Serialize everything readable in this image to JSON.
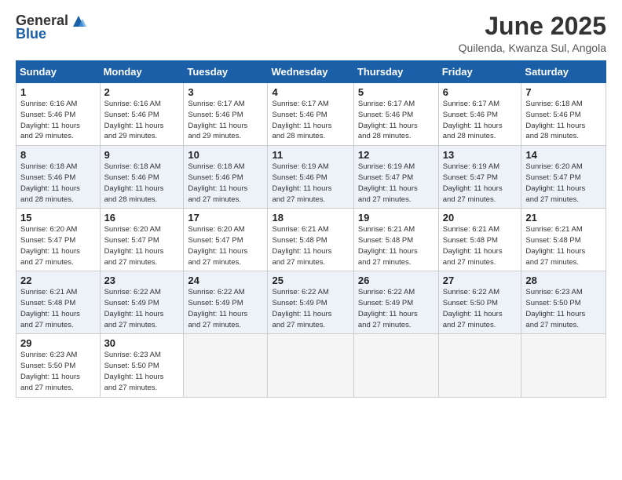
{
  "header": {
    "logo_general": "General",
    "logo_blue": "Blue",
    "month_title": "June 2025",
    "location": "Quilenda, Kwanza Sul, Angola"
  },
  "calendar": {
    "days_of_week": [
      "Sunday",
      "Monday",
      "Tuesday",
      "Wednesday",
      "Thursday",
      "Friday",
      "Saturday"
    ],
    "weeks": [
      [
        {
          "day": "",
          "info": ""
        },
        {
          "day": "2",
          "info": "Sunrise: 6:16 AM\nSunset: 5:46 PM\nDaylight: 11 hours\nand 29 minutes."
        },
        {
          "day": "3",
          "info": "Sunrise: 6:17 AM\nSunset: 5:46 PM\nDaylight: 11 hours\nand 29 minutes."
        },
        {
          "day": "4",
          "info": "Sunrise: 6:17 AM\nSunset: 5:46 PM\nDaylight: 11 hours\nand 28 minutes."
        },
        {
          "day": "5",
          "info": "Sunrise: 6:17 AM\nSunset: 5:46 PM\nDaylight: 11 hours\nand 28 minutes."
        },
        {
          "day": "6",
          "info": "Sunrise: 6:17 AM\nSunset: 5:46 PM\nDaylight: 11 hours\nand 28 minutes."
        },
        {
          "day": "7",
          "info": "Sunrise: 6:18 AM\nSunset: 5:46 PM\nDaylight: 11 hours\nand 28 minutes."
        }
      ],
      [
        {
          "day": "1",
          "info": "Sunrise: 6:16 AM\nSunset: 5:46 PM\nDaylight: 11 hours\nand 29 minutes.",
          "first": true
        },
        {
          "day": "8",
          "info": "Sunrise: 6:18 AM\nSunset: 5:46 PM\nDaylight: 11 hours\nand 28 minutes."
        },
        {
          "day": "9",
          "info": "Sunrise: 6:18 AM\nSunset: 5:46 PM\nDaylight: 11 hours\nand 28 minutes."
        },
        {
          "day": "10",
          "info": "Sunrise: 6:18 AM\nSunset: 5:46 PM\nDaylight: 11 hours\nand 27 minutes."
        },
        {
          "day": "11",
          "info": "Sunrise: 6:19 AM\nSunset: 5:46 PM\nDaylight: 11 hours\nand 27 minutes."
        },
        {
          "day": "12",
          "info": "Sunrise: 6:19 AM\nSunset: 5:47 PM\nDaylight: 11 hours\nand 27 minutes."
        },
        {
          "day": "13",
          "info": "Sunrise: 6:19 AM\nSunset: 5:47 PM\nDaylight: 11 hours\nand 27 minutes."
        },
        {
          "day": "14",
          "info": "Sunrise: 6:20 AM\nSunset: 5:47 PM\nDaylight: 11 hours\nand 27 minutes."
        }
      ],
      [
        {
          "day": "15",
          "info": "Sunrise: 6:20 AM\nSunset: 5:47 PM\nDaylight: 11 hours\nand 27 minutes."
        },
        {
          "day": "16",
          "info": "Sunrise: 6:20 AM\nSunset: 5:47 PM\nDaylight: 11 hours\nand 27 minutes."
        },
        {
          "day": "17",
          "info": "Sunrise: 6:20 AM\nSunset: 5:47 PM\nDaylight: 11 hours\nand 27 minutes."
        },
        {
          "day": "18",
          "info": "Sunrise: 6:21 AM\nSunset: 5:48 PM\nDaylight: 11 hours\nand 27 minutes."
        },
        {
          "day": "19",
          "info": "Sunrise: 6:21 AM\nSunset: 5:48 PM\nDaylight: 11 hours\nand 27 minutes."
        },
        {
          "day": "20",
          "info": "Sunrise: 6:21 AM\nSunset: 5:48 PM\nDaylight: 11 hours\nand 27 minutes."
        },
        {
          "day": "21",
          "info": "Sunrise: 6:21 AM\nSunset: 5:48 PM\nDaylight: 11 hours\nand 27 minutes."
        }
      ],
      [
        {
          "day": "22",
          "info": "Sunrise: 6:21 AM\nSunset: 5:48 PM\nDaylight: 11 hours\nand 27 minutes."
        },
        {
          "day": "23",
          "info": "Sunrise: 6:22 AM\nSunset: 5:49 PM\nDaylight: 11 hours\nand 27 minutes."
        },
        {
          "day": "24",
          "info": "Sunrise: 6:22 AM\nSunset: 5:49 PM\nDaylight: 11 hours\nand 27 minutes."
        },
        {
          "day": "25",
          "info": "Sunrise: 6:22 AM\nSunset: 5:49 PM\nDaylight: 11 hours\nand 27 minutes."
        },
        {
          "day": "26",
          "info": "Sunrise: 6:22 AM\nSunset: 5:49 PM\nDaylight: 11 hours\nand 27 minutes."
        },
        {
          "day": "27",
          "info": "Sunrise: 6:22 AM\nSunset: 5:50 PM\nDaylight: 11 hours\nand 27 minutes."
        },
        {
          "day": "28",
          "info": "Sunrise: 6:23 AM\nSunset: 5:50 PM\nDaylight: 11 hours\nand 27 minutes."
        }
      ],
      [
        {
          "day": "29",
          "info": "Sunrise: 6:23 AM\nSunset: 5:50 PM\nDaylight: 11 hours\nand 27 minutes."
        },
        {
          "day": "30",
          "info": "Sunrise: 6:23 AM\nSunset: 5:50 PM\nDaylight: 11 hours\nand 27 minutes."
        },
        {
          "day": "",
          "info": ""
        },
        {
          "day": "",
          "info": ""
        },
        {
          "day": "",
          "info": ""
        },
        {
          "day": "",
          "info": ""
        },
        {
          "day": "",
          "info": ""
        }
      ]
    ]
  }
}
